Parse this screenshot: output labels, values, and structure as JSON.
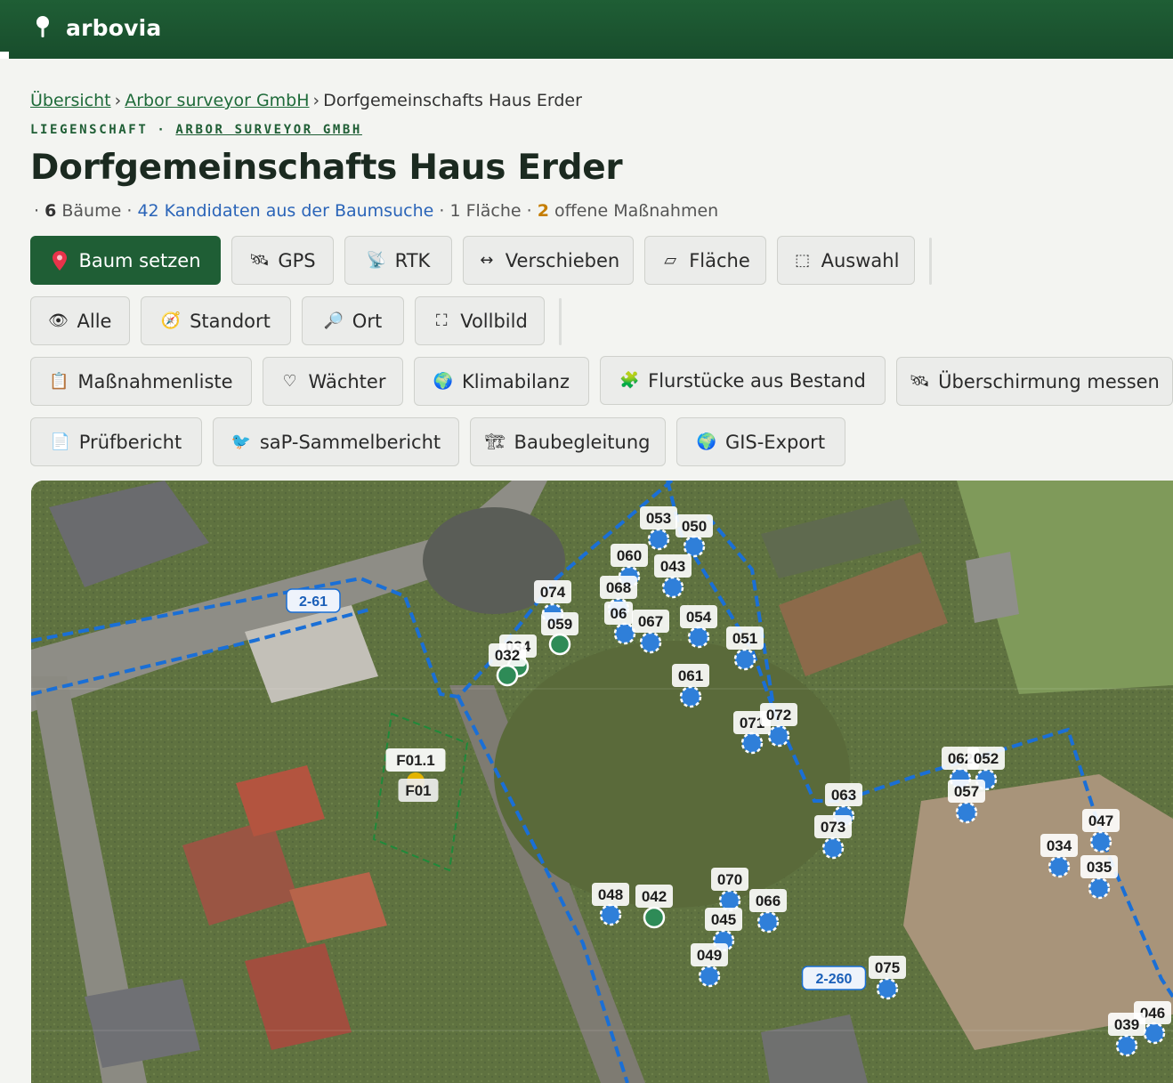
{
  "app": {
    "name": "arbovia",
    "logo_icon": "tree-pin-icon"
  },
  "breadcrumb": {
    "items": [
      "Übersicht",
      "Arbor surveyor GmbH"
    ],
    "current": "Dorfgemeinschafts Haus Erder",
    "separator": "›"
  },
  "eyebrow": {
    "type": "LIEGENSCHAFT",
    "dot": "·",
    "owner": "ARBOR SURVEYOR GMBH"
  },
  "page": {
    "title": "Dorfgemeinschafts Haus Erder"
  },
  "meta": {
    "lead": "·",
    "trees_count": "6",
    "trees_label": "Bäume",
    "sep": "·",
    "candidates_link": "42 Kandidaten aus der Baumsuche",
    "areas": "1 Fläche",
    "open_count": "2",
    "open_label": "offene Maßnahmen"
  },
  "toolbar_row1": [
    {
      "label": "Baum setzen",
      "icon": "📍",
      "icon_name": "map-pin-icon"
    },
    {
      "label": "GPS",
      "icon": "🛰",
      "icon_name": "satellite-icon"
    },
    {
      "label": "RTK",
      "icon": "📡",
      "icon_name": "antenna-icon"
    },
    {
      "label": "Verschieben",
      "icon": "↔",
      "icon_name": "move-icon"
    },
    {
      "label": "Fläche",
      "icon": "▱",
      "icon_name": "polygon-icon"
    },
    {
      "label": "Auswahl",
      "icon": "⬚",
      "icon_name": "selection-icon"
    }
  ],
  "toolbar_row2": [
    {
      "label": "Alle",
      "icon": "👁",
      "icon_name": "eye-icon"
    },
    {
      "label": "Standort",
      "icon": "🧭",
      "icon_name": "compass-icon"
    },
    {
      "label": "Ort",
      "icon": "🔎",
      "icon_name": "search-icon"
    },
    {
      "label": "Vollbild",
      "icon": "⛶",
      "icon_name": "fullscreen-icon"
    }
  ],
  "toolbar_row3": [
    {
      "label": "Maßnahmenliste",
      "icon": "📋",
      "icon_name": "clipboard-icon"
    },
    {
      "label": "Wächter",
      "icon": "♡",
      "icon_name": "heart-icon"
    },
    {
      "label": "Klimabilanz",
      "icon": "🌍",
      "icon_name": "globe-icon"
    },
    {
      "label": "Flurstücke aus Bestand",
      "icon": "🧩",
      "icon_name": "puzzle-icon"
    },
    {
      "label": "Überschirmung messen",
      "icon": "🛰",
      "icon_name": "satellite-icon"
    }
  ],
  "toolbar_row4": [
    {
      "label": "Prüfbericht",
      "icon": "📄",
      "icon_name": "document-icon"
    },
    {
      "label": "saP-Sammelbericht",
      "icon": "🐦",
      "icon_name": "bird-icon"
    },
    {
      "label": "Baubegleitung",
      "icon": "🏗",
      "icon_name": "construction-icon"
    },
    {
      "label": "GIS-Export",
      "icon": "🌍",
      "icon_name": "globe-icon"
    }
  ],
  "map": {
    "parcel_labels": [
      "2-61",
      "2-260"
    ],
    "area_labels": [
      "F01.1",
      "F01"
    ],
    "colors": {
      "candidate": "#2f7fd9",
      "tree": "#2e8b57",
      "area": "#1f8a3a",
      "parcel": "#1a6fd6",
      "warn": "#e3b400"
    },
    "tree_markers": [
      "053",
      "050",
      "060",
      "043",
      "074",
      "068",
      "059",
      "06",
      "067",
      "054",
      "051",
      "034",
      "032",
      "061",
      "071",
      "072",
      "062",
      "052",
      "063",
      "057",
      "073",
      "047",
      "034",
      "035",
      "048",
      "042",
      "070",
      "066",
      "045",
      "049",
      "075",
      "046",
      "039"
    ]
  }
}
